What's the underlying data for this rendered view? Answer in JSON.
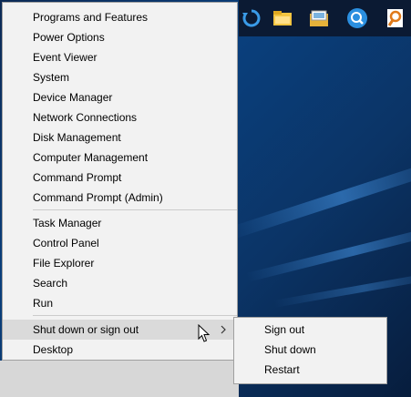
{
  "context_menu": {
    "groups": [
      [
        "Programs and Features",
        "Power Options",
        "Event Viewer",
        "System",
        "Device Manager",
        "Network Connections",
        "Disk Management",
        "Computer Management",
        "Command Prompt",
        "Command Prompt (Admin)"
      ],
      [
        "Task Manager",
        "Control Panel",
        "File Explorer",
        "Search",
        "Run"
      ],
      [
        "Shut down or sign out",
        "Desktop"
      ]
    ],
    "highlighted_item": "Shut down or sign out"
  },
  "submenu": {
    "items": [
      "Sign out",
      "Shut down",
      "Restart"
    ]
  },
  "taskbar": {
    "icons": [
      "edge-refresh-icon",
      "file-explorer-icon",
      "photos-icon",
      "search-icon",
      "image-search-icon"
    ]
  },
  "colors": {
    "menu_bg": "#f2f2f2",
    "highlight_bg": "#dadada",
    "desktop_bg": "#0a3f7c"
  }
}
